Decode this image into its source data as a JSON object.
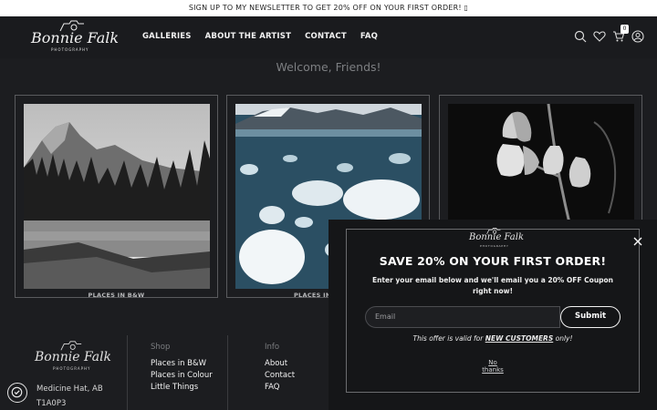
{
  "announcement": "SIGN UP TO MY NEWSLETTER TO GET 20% OFF ON YOUR FIRST ORDER! ▯",
  "brand": {
    "name": "Bonnie Falk",
    "tagline": "PHOTOGRAPHY"
  },
  "nav": [
    "GALLERIES",
    "ABOUT THE ARTIST",
    "CONTACT",
    "FAQ"
  ],
  "header_icons": [
    "search-icon",
    "heart-icon",
    "cart-icon",
    "account-icon"
  ],
  "cart_count": "0",
  "welcome": "Welcome, Friends!",
  "galleries": [
    {
      "caption": "PLACES IN B&W"
    },
    {
      "caption": "PLACES IN COLOUR"
    },
    {
      "caption": ""
    }
  ],
  "footer": {
    "address_line1": "Medicine Hat, AB",
    "address_line2": "T1A0P3",
    "shop": {
      "title": "Shop",
      "links": [
        "Places in B&W",
        "Places in Colour",
        "Little Things"
      ]
    },
    "info": {
      "title": "Info",
      "links": [
        "About",
        "Contact",
        "FAQ"
      ]
    }
  },
  "popup": {
    "title": "SAVE 20% ON YOUR FIRST ORDER!",
    "description": "Enter your email below and we'll email you a 20% OFF Coupon right now!",
    "email_placeholder": "Email",
    "submit_label": "Submit",
    "offer_prefix": "This offer is valid for ",
    "offer_emphasis": "NEW CUSTOMERS",
    "offer_suffix": " only!",
    "no_thanks_line1": "No",
    "no_thanks_line2": "thanks"
  }
}
